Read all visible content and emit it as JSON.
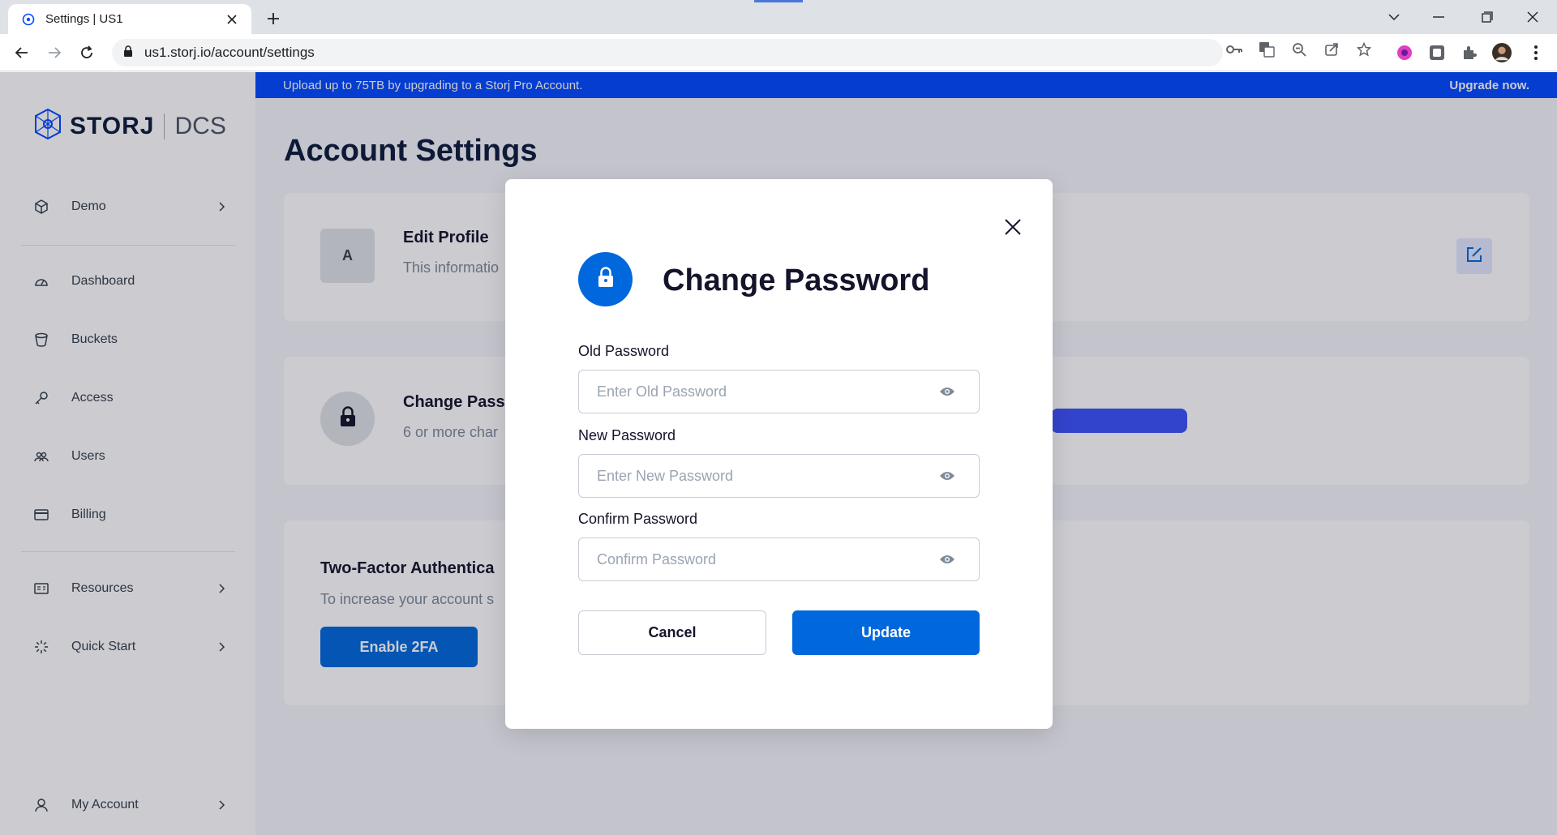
{
  "browser": {
    "tab_title": "Settings | US1",
    "url": "us1.storj.io/account/settings"
  },
  "banner": {
    "text": "Upload up to 75TB by upgrading to a Storj Pro Account.",
    "action": "Upgrade now."
  },
  "logo": {
    "brand": "STORJ",
    "product": "DCS"
  },
  "sidebar": {
    "project": "Demo",
    "items": [
      "Dashboard",
      "Buckets",
      "Access",
      "Users",
      "Billing"
    ],
    "resources": "Resources",
    "quick_start": "Quick Start",
    "my_account": "My Account"
  },
  "page": {
    "title": "Account Settings",
    "edit_profile": {
      "avatar_letter": "A",
      "heading": "Edit Profile",
      "sub": "This informatio"
    },
    "change_password": {
      "heading": "Change Pass",
      "sub": "6 or more char"
    },
    "two_factor": {
      "heading": "Two-Factor Authentica",
      "sub": "To increase your account s",
      "button": "Enable 2FA"
    }
  },
  "modal": {
    "title": "Change Password",
    "fields": [
      {
        "label": "Old Password",
        "placeholder": "Enter Old Password"
      },
      {
        "label": "New Password",
        "placeholder": "Enter New Password"
      },
      {
        "label": "Confirm Password",
        "placeholder": "Confirm Password"
      }
    ],
    "cancel": "Cancel",
    "update": "Update"
  },
  "colors": {
    "primary": "#0068dc",
    "banner": "#0149ff",
    "overlay": "rgba(20,20,43,0.22)"
  }
}
